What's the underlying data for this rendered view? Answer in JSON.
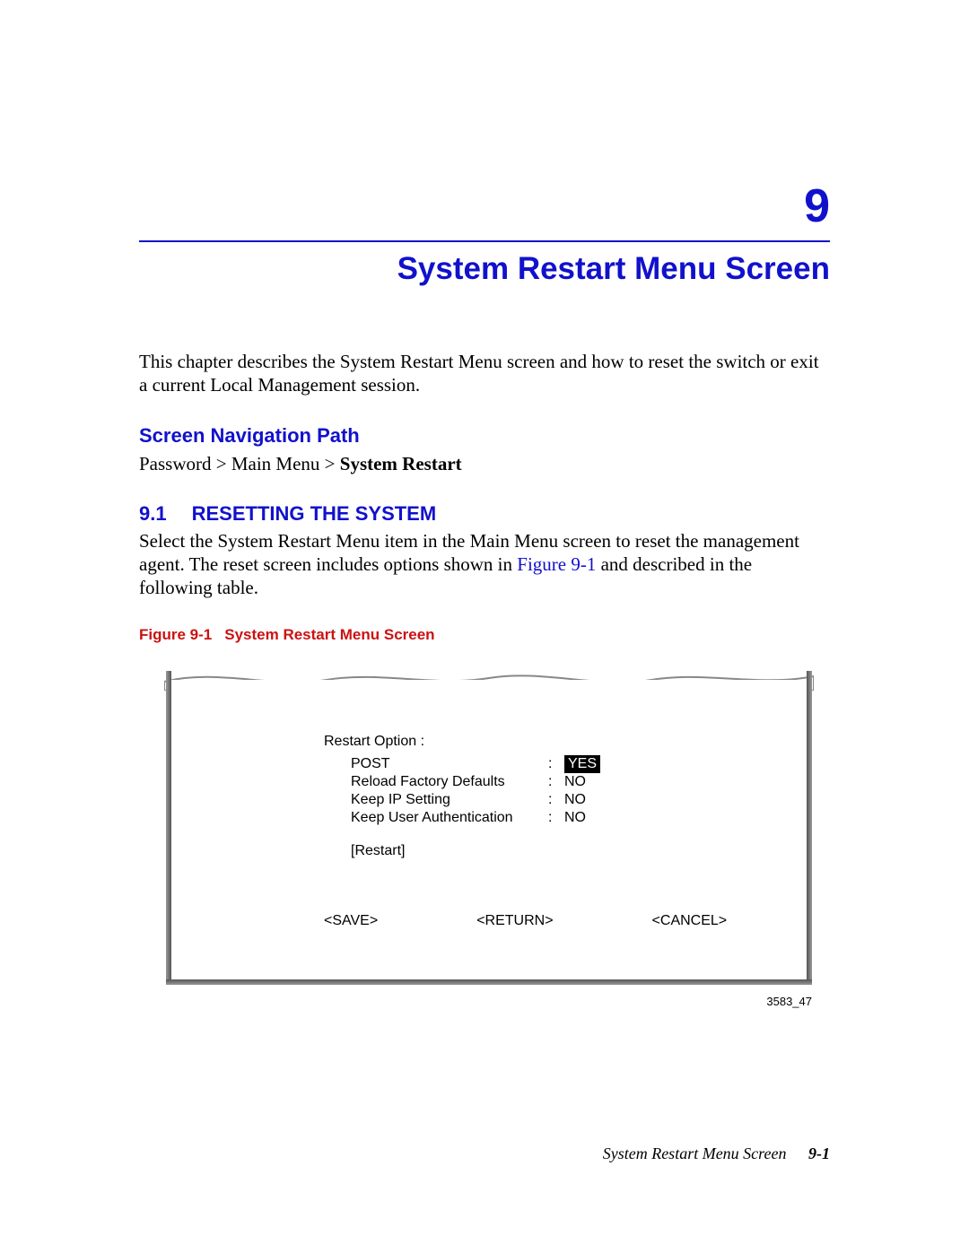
{
  "chapter": {
    "number": "9",
    "title": "System Restart Menu Screen"
  },
  "intro": "This chapter describes the System Restart Menu screen and how to reset the switch or exit a current Local Management session.",
  "nav": {
    "heading": "Screen Navigation Path",
    "path_prefix": "Password > Main Menu > ",
    "path_bold": "System Restart"
  },
  "section": {
    "number": "9.1",
    "title": "RESETTING THE SYSTEM",
    "text_before_link": "Select the System Restart Menu item in the Main Menu screen to reset the management agent. The reset screen includes options shown in ",
    "link_text": "Figure 9-1",
    "text_after_link": " and described in the following table."
  },
  "figure": {
    "caption_num": "Figure 9-1",
    "caption_title": "System Restart Menu Screen",
    "restart_option_label": "Restart Option :",
    "options": [
      {
        "label": "POST",
        "value": "YES",
        "selected": true
      },
      {
        "label": "Reload Factory Defaults",
        "value": "NO",
        "selected": false
      },
      {
        "label": "Keep IP Setting",
        "value": "NO",
        "selected": false
      },
      {
        "label": "Keep User Authentication",
        "value": "NO",
        "selected": false
      }
    ],
    "restart_button": "[Restart]",
    "commands": {
      "save": "<SAVE>",
      "return": "<RETURN>",
      "cancel": "<CANCEL>"
    },
    "figure_id": "3583_47"
  },
  "footer": {
    "title": "System Restart Menu Screen",
    "page": "9-1"
  }
}
